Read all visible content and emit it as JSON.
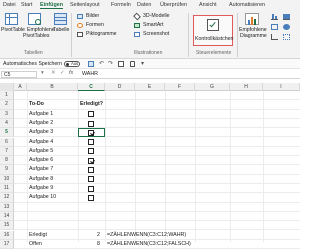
{
  "tabs": [
    "Datei",
    "Start",
    "Einfügen",
    "Seitenlayout",
    "Formeln",
    "Daten",
    "Überprüfen",
    "Ansicht",
    "Automatisieren"
  ],
  "active_tab": "Einfügen",
  "ribbon": {
    "pivottable": "PivotTable",
    "empfohlene_pivottables": [
      "Empfohlene",
      "PivotTables"
    ],
    "tabelle": "Tabelle",
    "bilder": "Bilder",
    "formen": "Formen",
    "piktogramme": "Piktogramme",
    "modelle3d": "3D-Modelle",
    "smartart": "SmartArt",
    "screenshot": "Screenshot",
    "kontrollkaestchen": "Kontrollkästchen",
    "empfohlene_diagramme": [
      "Empfohlene",
      "Diagramme"
    ],
    "groups": {
      "tabellen": "Tabellen",
      "illustrationen": "Illustrationen",
      "steuerelemente": "Steuerelemente"
    }
  },
  "qbar": {
    "autosave_label": "Automatisches Speichern",
    "toggle_state": "Aus"
  },
  "formula_bar": {
    "name_box": "C5",
    "formula": "WAHR"
  },
  "columns": [
    "A",
    "B",
    "C",
    "D",
    "E",
    "F",
    "G",
    "H",
    "I"
  ],
  "rows": [
    "1",
    "2",
    "3",
    "4",
    "5",
    "6",
    "7",
    "8",
    "9",
    "10",
    "11",
    "12",
    "13",
    "14",
    "15",
    "16",
    "17"
  ],
  "sheet": {
    "header_todo": "To-Do",
    "header_erledigt": "Erledigt?",
    "tasks": [
      "Aufgabe 1",
      "Aufgabe 2",
      "Aufgabe 3",
      "Aufgabe 4",
      "Aufgabe 5",
      "Aufgabe 6",
      "Aufgabe 7",
      "Aufgabe 8",
      "Aufgabe 9",
      "Aufgabe 10"
    ],
    "checked": [
      false,
      false,
      true,
      false,
      false,
      true,
      false,
      false,
      false,
      false
    ],
    "summary": [
      {
        "label": "Erledigt",
        "value": "2",
        "formula": "=ZÄHLENWENN(C3:C12;WAHR)"
      },
      {
        "label": "Offen",
        "value": "8",
        "formula": "=ZÄHLENWENN(C3:C12;FALSCH)"
      }
    ]
  },
  "colors": {
    "accent": "#1e7145",
    "highlight_box": "#e05a5a",
    "selection": "#1e7145"
  }
}
